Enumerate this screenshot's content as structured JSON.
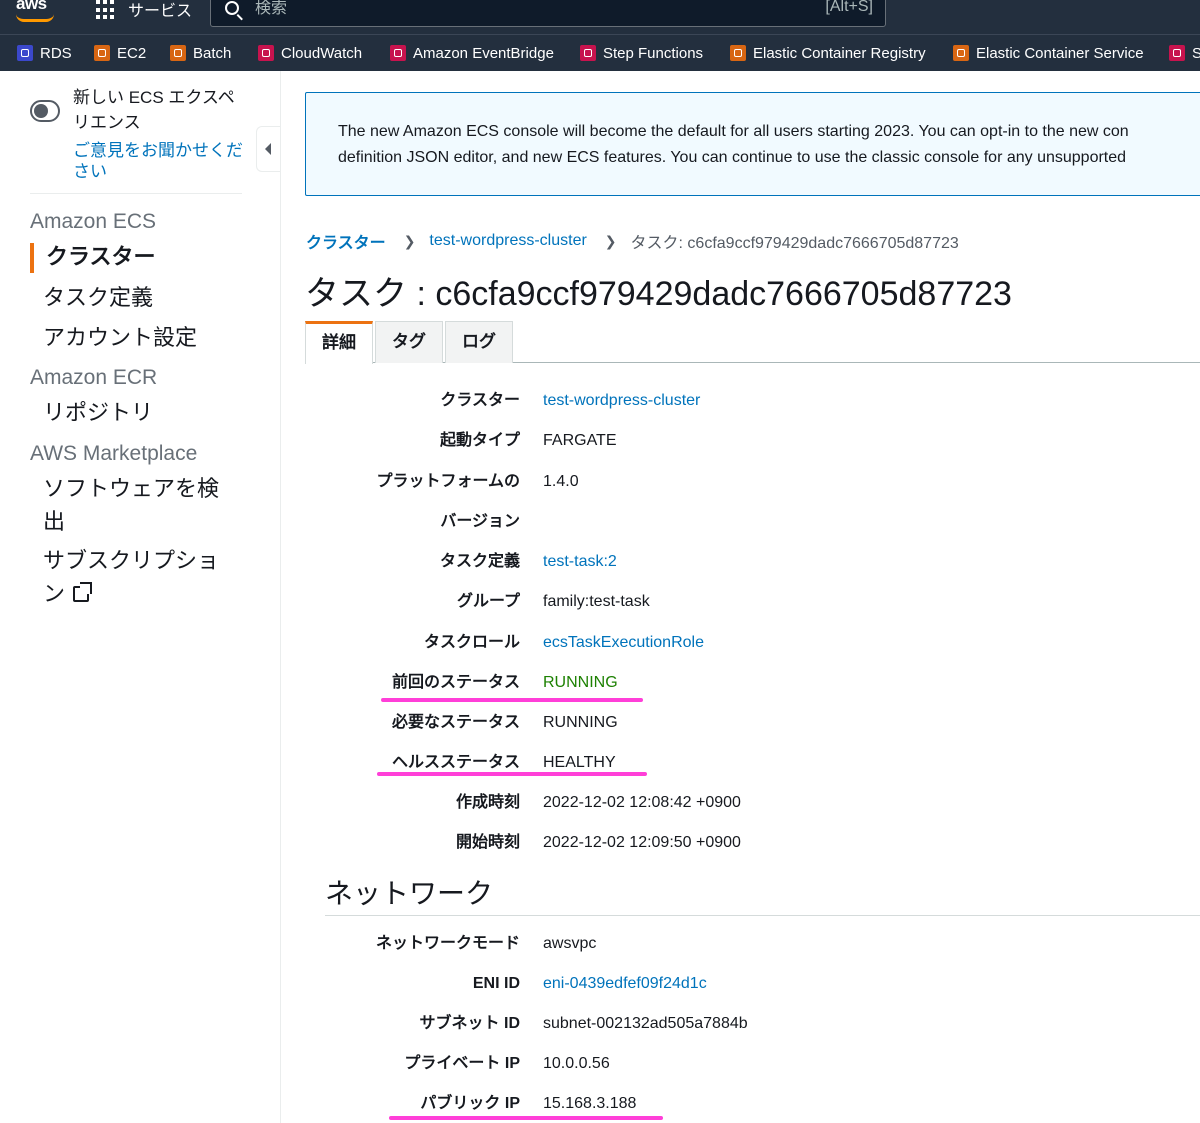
{
  "topbar": {
    "logo": "aws",
    "services_label": "サービス",
    "search_placeholder": "検索",
    "search_shortcut": "[Alt+S]"
  },
  "favorites": [
    {
      "label": "RDS",
      "icon": "rds-icon",
      "color": "#3b48cc"
    },
    {
      "label": "EC2",
      "icon": "ec2-icon",
      "color": "#d86613"
    },
    {
      "label": "Batch",
      "icon": "batch-icon",
      "color": "#d86613"
    },
    {
      "label": "CloudWatch",
      "icon": "cloudwatch-icon",
      "color": "#c7134e"
    },
    {
      "label": "Amazon EventBridge",
      "icon": "eventbridge-icon",
      "color": "#c7134e"
    },
    {
      "label": "Step Functions",
      "icon": "step-functions-icon",
      "color": "#c7134e"
    },
    {
      "label": "Elastic Container Registry",
      "icon": "ecr-icon",
      "color": "#d86613"
    },
    {
      "label": "Elastic Container Service",
      "icon": "ecs-icon",
      "color": "#d86613"
    },
    {
      "label": "S",
      "icon": "service-icon",
      "color": "#c7134e"
    }
  ],
  "sidebar": {
    "new_experience": "新しい ECS エクスペリエンス",
    "feedback": "ご意見をお聞かせください",
    "sections": [
      {
        "title": "Amazon ECS"
      },
      {
        "title": "Amazon ECR"
      },
      {
        "title": "AWS Marketplace"
      }
    ],
    "items": [
      {
        "label": "クラスター"
      },
      {
        "label": "タスク定義"
      },
      {
        "label": "アカウント設定"
      },
      {
        "label": "リポジトリ"
      },
      {
        "label": "ソフトウェアを検出"
      },
      {
        "label": "サブスクリプション"
      }
    ]
  },
  "banner": {
    "line1": "The new Amazon ECS console will become the default for all users starting 2023. You can opt-in to the new con",
    "line2": "definition JSON editor, and new ECS features. You can continue to use the classic console for any unsupported"
  },
  "breadcrumb": {
    "root": "クラスター",
    "cluster": "test-wordpress-cluster",
    "current": "タスク: c6cfa9ccf979429dadc7666705d87723"
  },
  "page_title": "タスク : c6cfa9ccf979429dadc7666705d87723",
  "tabs": [
    {
      "label": "詳細"
    },
    {
      "label": "タグ"
    },
    {
      "label": "ログ"
    }
  ],
  "details": [
    {
      "label": "クラスター",
      "value": "test-wordpress-cluster"
    },
    {
      "label": "起動タイプ",
      "value": "FARGATE"
    },
    {
      "label": "プラットフォームの",
      "value": "1.4.0"
    },
    {
      "label": "バージョン",
      "value": ""
    },
    {
      "label": "タスク定義",
      "value": "test-task:2"
    },
    {
      "label": "グループ",
      "value": "family:test-task"
    },
    {
      "label": "タスクロール",
      "value": "ecsTaskExecutionRole"
    },
    {
      "label": "前回のステータス",
      "value": "RUNNING"
    },
    {
      "label": "必要なステータス",
      "value": "RUNNING"
    },
    {
      "label": "ヘルスステータス",
      "value": "HEALTHY"
    },
    {
      "label": "作成時刻",
      "value": "2022-12-02 12:08:42 +0900"
    },
    {
      "label": "開始時刻",
      "value": "2022-12-02 12:09:50 +0900"
    }
  ],
  "network": {
    "title": "ネットワーク",
    "rows": [
      {
        "label": "ネットワークモード",
        "value": "awsvpc"
      },
      {
        "label": "ENI ID",
        "value": "eni-0439edfef09f24d1c"
      },
      {
        "label": "サブネット ID",
        "value": "subnet-002132ad505a7884b"
      },
      {
        "label": "プライベート IP",
        "value": "10.0.0.56"
      },
      {
        "label": "パブリック IP",
        "value": "15.168.3.188"
      }
    ]
  },
  "colors": {
    "accent": "#ec7211",
    "link": "#0073bb",
    "running_green": "#1d8102",
    "highlight": "#ff3fd8"
  }
}
